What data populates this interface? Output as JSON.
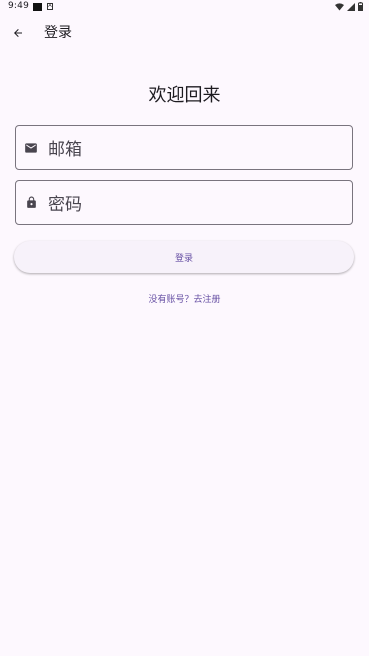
{
  "status_bar": {
    "time": "9:49",
    "notification_icon_a": "A"
  },
  "app_bar": {
    "title": "登录",
    "back_icon": "arrow-back-icon"
  },
  "welcome_title": "欢迎回来",
  "form": {
    "email_placeholder": "邮箱",
    "email_icon": "mail-icon",
    "password_placeholder": "密码",
    "password_icon": "lock-icon",
    "login_button": "登录",
    "register_link": "没有账号？去注册"
  },
  "colors": {
    "background": "#fdf8fe",
    "primary": "#6750a4",
    "outline": "#79747e",
    "on_surface": "#1d1b20"
  }
}
